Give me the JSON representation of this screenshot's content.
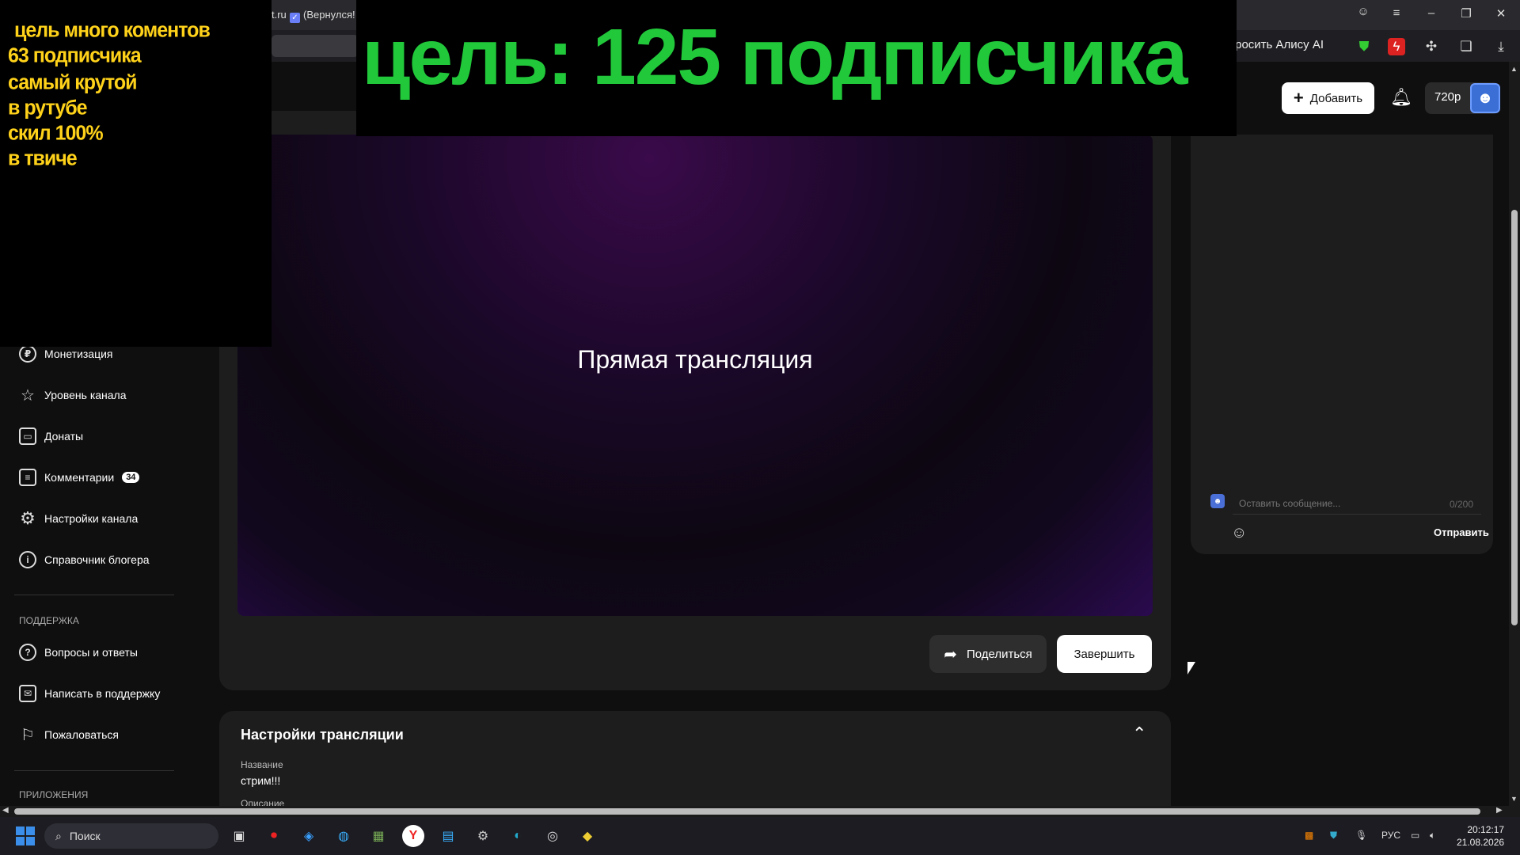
{
  "browser": {
    "tab_fragment": "t.ru",
    "tab_title": "(Вернулся!",
    "alice_label": "просить Алису AI"
  },
  "topbar": {
    "add_label": "Добавить",
    "quality": "720p"
  },
  "sidebar": {
    "items": [
      {
        "label": "Монетизация",
        "icon": "ruble-icon"
      },
      {
        "label": "Уровень канала",
        "icon": "star-icon"
      },
      {
        "label": "Донаты",
        "icon": "wallet-icon"
      },
      {
        "label": "Комментарии",
        "icon": "comment-icon",
        "badge": "34"
      },
      {
        "label": "Настройки канала",
        "icon": "gear-icon"
      },
      {
        "label": "Справочник блогера",
        "icon": "info-icon"
      }
    ],
    "support_heading": "ПОДДЕРЖКА",
    "support_items": [
      {
        "label": "Вопросы и ответы",
        "icon": "question-icon"
      },
      {
        "label": "Написать в поддержку",
        "icon": "mail-icon"
      },
      {
        "label": "Пожаловаться",
        "icon": "flag-icon"
      }
    ],
    "apps_heading": "ПРИЛОЖЕНИЯ"
  },
  "player": {
    "title": "Прямая трансляция"
  },
  "actions": {
    "share": "Поделиться",
    "end": "Завершить"
  },
  "settings": {
    "title": "Настройки трансляции",
    "name_label": "Название",
    "name_value": "стрим!!!",
    "desc_label": "Описание"
  },
  "chat": {
    "placeholder": "Оставить сообщение...",
    "counter": "0/200",
    "send": "Отправить"
  },
  "overlay": {
    "left_lines": [
      "цель много коментов",
      " 63 подписчика",
      "самый крутой",
      "в рутубе",
      "скил 100%",
      "в твиче"
    ],
    "goal": "цель: 125 подписчика"
  },
  "taskbar": {
    "search": "Поиск",
    "lang": "РУС",
    "time": "20:12:17",
    "date": "21.08.2026"
  }
}
